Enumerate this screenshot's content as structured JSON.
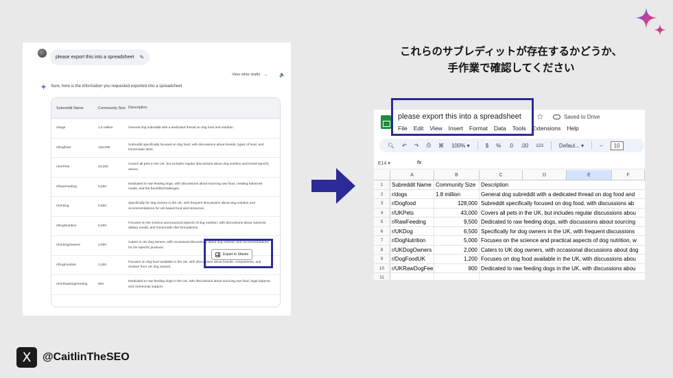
{
  "chat": {
    "prompt": "please export this into a spreadsheet",
    "view_drafts": "View other drafts",
    "answer_intro": "Sure, here is the information you requested exported into a spreadsheet",
    "headers": [
      "Subreddit Name",
      "Community Size",
      "Description"
    ],
    "rows": [
      [
        "r/dogs",
        "1.8 million",
        "General dog subreddit with a dedicated thread on dog food and nutrition."
      ],
      [
        "r/Dogfood",
        "128,000",
        "Subreddit specifically focused on dog food, with discussions about brands, types of food, and homemade diets."
      ],
      [
        "r/UKPets",
        "43,000",
        "Covers all pets in the UK, but includes regular discussions about dog nutrition and breed-specific advice."
      ],
      [
        "r/RawFeeding",
        "9,500",
        "Dedicated to raw feeding dogs, with discussions about sourcing raw food, creating balanced meals, and the benefits/challenges."
      ],
      [
        "r/UKDog",
        "6,500",
        "Specifically for dog owners in the UK, with frequent discussions about dog nutrition and recommendations for UK-based food and resources."
      ],
      [
        "r/DogNutrition",
        "5,000",
        "Focuses on the science and practical aspects of dog nutrition, with discussions about nutrients, dietary needs, and homemade diet formulations."
      ],
      [
        "r/UKDogOwners",
        "2,000",
        "Caters to UK dog owners, with occasional discussions about dog nutrition and recommendations for UK-specific products."
      ],
      [
        "r/DogFoodUK",
        "1,200",
        "Focuses on dog food available in the UK, with discussions about brands, comparisons, and reviews from UK dog owners."
      ],
      [
        "r/UKRawDogFeeding",
        "800",
        "Dedicated to raw feeding dogs in the UK, with discussions about sourcing raw food, legal aspects, and community support."
      ]
    ],
    "export_button": "Export to Sheets"
  },
  "caption": {
    "line1": "これらのサブレディットが存在するかどうか、",
    "line2": "手作業で確認してください"
  },
  "sheets": {
    "title": "please export this into a spreadsheet",
    "saved": "Saved to Drive",
    "menu": [
      "File",
      "Edit",
      "View",
      "Insert",
      "Format",
      "Data",
      "Tools",
      "Extensions",
      "Help"
    ],
    "zoom": "100%",
    "currency": "$",
    "percent": "%",
    "dec_less": ".0",
    "dec_more": ".00",
    "num_format": "123",
    "font": "Defaul...",
    "font_size": "10",
    "cell_ref": "E14",
    "columns": [
      "A",
      "B",
      "C",
      "D",
      "E",
      "F"
    ],
    "rows": [
      {
        "n": "1",
        "a": "Subreddit Name",
        "b": "Community Size",
        "c": "Description"
      },
      {
        "n": "2",
        "a": "r/dogs",
        "b": "1.8 million",
        "c": "General dog subreddit with a dedicated thread on dog food and"
      },
      {
        "n": "3",
        "a": "r/Dogfood",
        "b": "128,000",
        "c": "Subreddit specifically focused on dog food, with discussions ab"
      },
      {
        "n": "4",
        "a": "r/UKPets",
        "b": "43,000",
        "c": "Covers all pets in the UK, but includes regular discussions abou"
      },
      {
        "n": "5",
        "a": "r/RawFeeding",
        "b": "9,500",
        "c": "Dedicated to raw feeding dogs, with discussions about sourcing"
      },
      {
        "n": "6",
        "a": "r/UKDog",
        "b": "6,500",
        "c": "Specifically for dog owners in the UK, with frequent discussions"
      },
      {
        "n": "7",
        "a": "r/DogNutrition",
        "b": "5,000",
        "c": "Focuses on the science and practical aspects of dog nutrition, w"
      },
      {
        "n": "8",
        "a": "r/UKDogOwners",
        "b": "2,000",
        "c": "Caters to UK dog owners, with occasional discussions about dog"
      },
      {
        "n": "9",
        "a": "r/DogFoodUK",
        "b": "1,200",
        "c": "Focuses on dog food available in the UK, with discussions abou"
      },
      {
        "n": "10",
        "a": "r/UKRawDogFee",
        "b": "800",
        "c": "Dedicated to raw feeding dogs in the UK, with discussions abou"
      },
      {
        "n": "11",
        "a": "",
        "b": "",
        "c": ""
      }
    ]
  },
  "footer": {
    "handle": "@CaitlinTheSEO",
    "x_logo": "X"
  },
  "colors": {
    "highlight_box": "#2b2a96",
    "arrow": "#2b2a96",
    "sheets_green": "#1e8e3e"
  }
}
